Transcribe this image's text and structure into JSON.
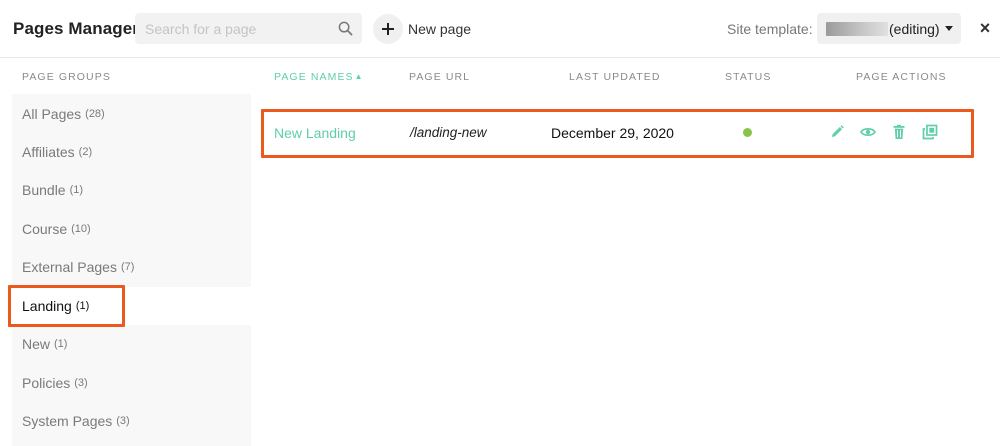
{
  "header": {
    "title": "Pages Manager",
    "search_placeholder": "Search for a page",
    "new_page_label": "New page",
    "site_template_label": "Site template:",
    "site_template_value": "(editing)",
    "close_label": "×"
  },
  "sidebar": {
    "heading": "PAGE GROUPS",
    "items": [
      {
        "label": "All Pages",
        "count": "(28)"
      },
      {
        "label": "Affiliates",
        "count": "(2)"
      },
      {
        "label": "Bundle",
        "count": "(1)"
      },
      {
        "label": "Course",
        "count": "(10)"
      },
      {
        "label": "External Pages",
        "count": "(7)"
      },
      {
        "label": "Landing",
        "count": "(1)"
      },
      {
        "label": "New",
        "count": "(1)"
      },
      {
        "label": "Policies",
        "count": "(3)"
      },
      {
        "label": "System Pages",
        "count": "(3)"
      }
    ],
    "active_item": "Landing"
  },
  "table": {
    "columns": {
      "name": "PAGE NAMES",
      "sort_indicator": "▲",
      "url": "PAGE URL",
      "updated": "LAST UPDATED",
      "status": "STATUS",
      "actions": "PAGE ACTIONS"
    },
    "rows": [
      {
        "name": "New Landing",
        "url": "/landing-new",
        "last_updated": "December 29, 2020",
        "status": "published",
        "actions": [
          "edit-icon",
          "preview-icon",
          "delete-icon",
          "duplicate-icon"
        ]
      }
    ]
  },
  "colors": {
    "accent": "#5fcfa8",
    "status_active": "#8bc34a",
    "highlight": "#ea5a1e",
    "sidebar_bg": "#f8f8f8"
  }
}
